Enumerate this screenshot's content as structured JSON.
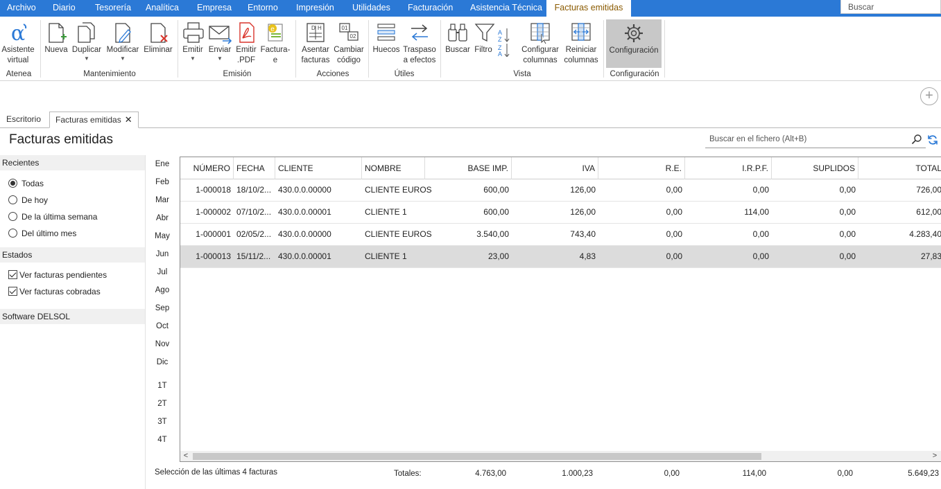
{
  "menu": {
    "items": [
      "Archivo",
      "Diario",
      "Tesorería",
      "Analítica",
      "Empresa",
      "Entorno",
      "Impresión",
      "Utilidades",
      "Facturación",
      "Asistencia Técnica",
      "Facturas emitidas"
    ],
    "active": "Facturas emitidas",
    "search_placeholder": "Buscar"
  },
  "ribbon": {
    "buttons": {
      "asistente": [
        "Asistente",
        "virtual"
      ],
      "nueva": "Nueva",
      "duplicar": "Duplicar",
      "modificar": "Modificar",
      "eliminar": "Eliminar",
      "emitir": "Emitir",
      "enviar": "Enviar",
      "emitir_pdf": [
        "Emitir",
        ".PDF"
      ],
      "facturae": [
        "Factura-",
        "e"
      ],
      "asentar": [
        "Asentar",
        "facturas"
      ],
      "cambiar": [
        "Cambiar",
        "código"
      ],
      "huecos": "Huecos",
      "traspaso": [
        "Traspaso",
        "a efectos"
      ],
      "buscar": "Buscar",
      "filtro": "Filtro",
      "configurar": [
        "Configurar",
        "columnas"
      ],
      "reiniciar": [
        "Reiniciar",
        "columnas"
      ],
      "configuracion": "Configuración"
    },
    "groups": {
      "atenea": "Atenea",
      "mantenimiento": "Mantenimiento",
      "emision": "Emisión",
      "acciones": "Acciones",
      "utiles": "Útiles",
      "vista": "Vista",
      "configuracion": "Configuración"
    }
  },
  "tabs": {
    "escritorio": "Escritorio",
    "facturas": "Facturas emitidas"
  },
  "page": {
    "title": "Facturas emitidas",
    "search_placeholder": "Buscar en el fichero (Alt+B)"
  },
  "filters": {
    "recientes_title": "Recientes",
    "recientes": [
      {
        "label": "Todas",
        "checked": true
      },
      {
        "label": "De hoy",
        "checked": false
      },
      {
        "label": "De la última semana",
        "checked": false
      },
      {
        "label": "Del último mes",
        "checked": false
      }
    ],
    "estados_title": "Estados",
    "estados": [
      {
        "label": "Ver facturas pendientes",
        "checked": true
      },
      {
        "label": "Ver facturas cobradas",
        "checked": true
      }
    ],
    "software": "Software DELSOL"
  },
  "months": [
    "Ene",
    "Feb",
    "Mar",
    "Abr",
    "May",
    "Jun",
    "Jul",
    "Ago",
    "Sep",
    "Oct",
    "Nov",
    "Dic"
  ],
  "quarters": [
    "1T",
    "2T",
    "3T",
    "4T"
  ],
  "table": {
    "columns": [
      "NÚMERO",
      "FECHA",
      "CLIENTE",
      "NOMBRE",
      "BASE IMP.",
      "IVA",
      "R.E.",
      "I.R.P.F.",
      "SUPLIDOS",
      "TOTAL"
    ],
    "rows": [
      [
        "1-000018",
        "18/10/2...",
        "430.0.0.00000",
        "CLIENTE EUROS",
        "600,00",
        "126,00",
        "0,00",
        "0,00",
        "0,00",
        "726,00"
      ],
      [
        "1-000002",
        "07/10/2...",
        "430.0.0.00001",
        "CLIENTE 1",
        "600,00",
        "126,00",
        "0,00",
        "114,00",
        "0,00",
        "612,00"
      ],
      [
        "1-000001",
        "02/05/2...",
        "430.0.0.00000",
        "CLIENTE EUROS",
        "3.540,00",
        "743,40",
        "0,00",
        "0,00",
        "0,00",
        "4.283,40"
      ],
      [
        "1-000013",
        "15/11/2...",
        "430.0.0.00001",
        "CLIENTE 1",
        "23,00",
        "4,83",
        "0,00",
        "0,00",
        "0,00",
        "27,83"
      ]
    ],
    "selected_row": 3
  },
  "footer": {
    "selection": "Selección de las últimas 4 facturas",
    "totals_label": "Totales:",
    "totals": [
      "4.763,00",
      "1.000,23",
      "0,00",
      "114,00",
      "0,00",
      "5.649,23"
    ]
  },
  "colors": {
    "menubar": "#2b79d6",
    "active_menu_text": "#8a5a00",
    "accent": "#2b79d6",
    "pdf_red": "#d9342b",
    "add_green": "#3a9a3a"
  }
}
